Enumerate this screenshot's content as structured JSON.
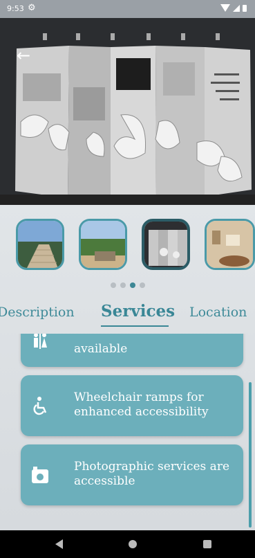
{
  "status_bar": {
    "time": "9:53",
    "icons": [
      "gear-icon",
      "wifi-icon",
      "signal-icon",
      "battery-icon"
    ]
  },
  "hero": {
    "back_icon": "arrow-left-icon"
  },
  "thumbnails": [
    {
      "name": "stairs-photo",
      "active": false
    },
    {
      "name": "park-photo",
      "active": false
    },
    {
      "name": "exhibit-wall-photo",
      "active": true
    },
    {
      "name": "interior-photo",
      "active": false
    }
  ],
  "pagination": {
    "count": 4,
    "active": 2
  },
  "tabs": [
    {
      "label": "Description",
      "active": false
    },
    {
      "label": "Services",
      "active": true
    },
    {
      "label": "Location",
      "active": false
    }
  ],
  "services": [
    {
      "icon": "restroom-icon",
      "text": "available"
    },
    {
      "icon": "wheelchair-icon",
      "text": "Wheelchair ramps for enhanced accessibility"
    },
    {
      "icon": "camera-icon",
      "text": "Photographic services are accessible"
    }
  ],
  "colors": {
    "accent": "#3a8796",
    "card": "#6cafbb"
  }
}
